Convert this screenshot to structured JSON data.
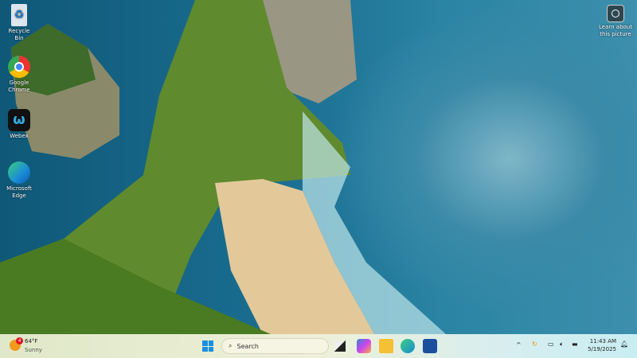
{
  "desktop": {
    "icons": [
      {
        "label": "Recycle Bin",
        "icon": "recycle-bin-icon"
      },
      {
        "label": "Google Chrome",
        "icon": "chrome-icon"
      },
      {
        "label": "Webex",
        "icon": "webex-icon"
      },
      {
        "label": "Microsoft Edge",
        "icon": "edge-icon"
      }
    ],
    "learn_about": "Learn about this picture"
  },
  "taskbar": {
    "weather": {
      "temp": "64°F",
      "condition": "Sunny",
      "badge": "4"
    },
    "search_placeholder": "Search",
    "apps": [
      "start-icon",
      "task-view-icon",
      "copilot-icon",
      "file-explorer-icon",
      "edge-icon",
      "store-icon"
    ],
    "time": "11:43 AM",
    "date": "5/19/2025"
  }
}
